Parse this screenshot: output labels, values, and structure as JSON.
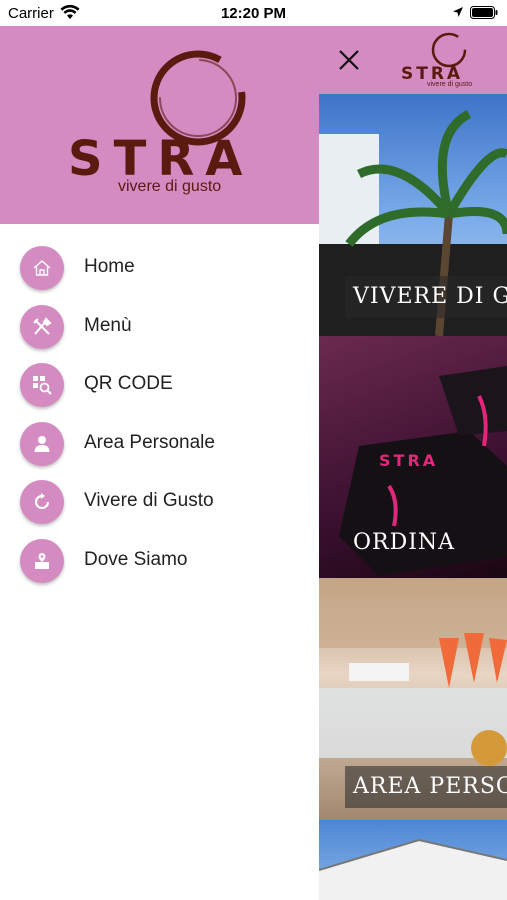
{
  "status_bar": {
    "carrier": "Carrier",
    "time": "12:20 PM"
  },
  "drawer": {
    "logo": {
      "name": "STRA",
      "tagline": "vivere di gusto"
    },
    "items": [
      {
        "label": "Home",
        "icon": "home-icon"
      },
      {
        "label": "Menù",
        "icon": "cutlery-icon"
      },
      {
        "label": "QR CODE",
        "icon": "qr-search-icon"
      },
      {
        "label": "Area Personale",
        "icon": "user-icon"
      },
      {
        "label": "Vivere di Gusto",
        "icon": "refresh-icon"
      },
      {
        "label": "Dove Siamo",
        "icon": "map-pin-icon"
      }
    ]
  },
  "main": {
    "logo": {
      "name": "STRA",
      "tagline": "vivere di gusto"
    },
    "tiles": [
      {
        "caption": "VIVERE DI G"
      },
      {
        "caption": "ORDINA"
      },
      {
        "caption": "AREA PERSO"
      },
      {
        "caption": ""
      }
    ]
  },
  "colors": {
    "accent": "#d48bc1",
    "brand_text": "#5a1a10"
  }
}
